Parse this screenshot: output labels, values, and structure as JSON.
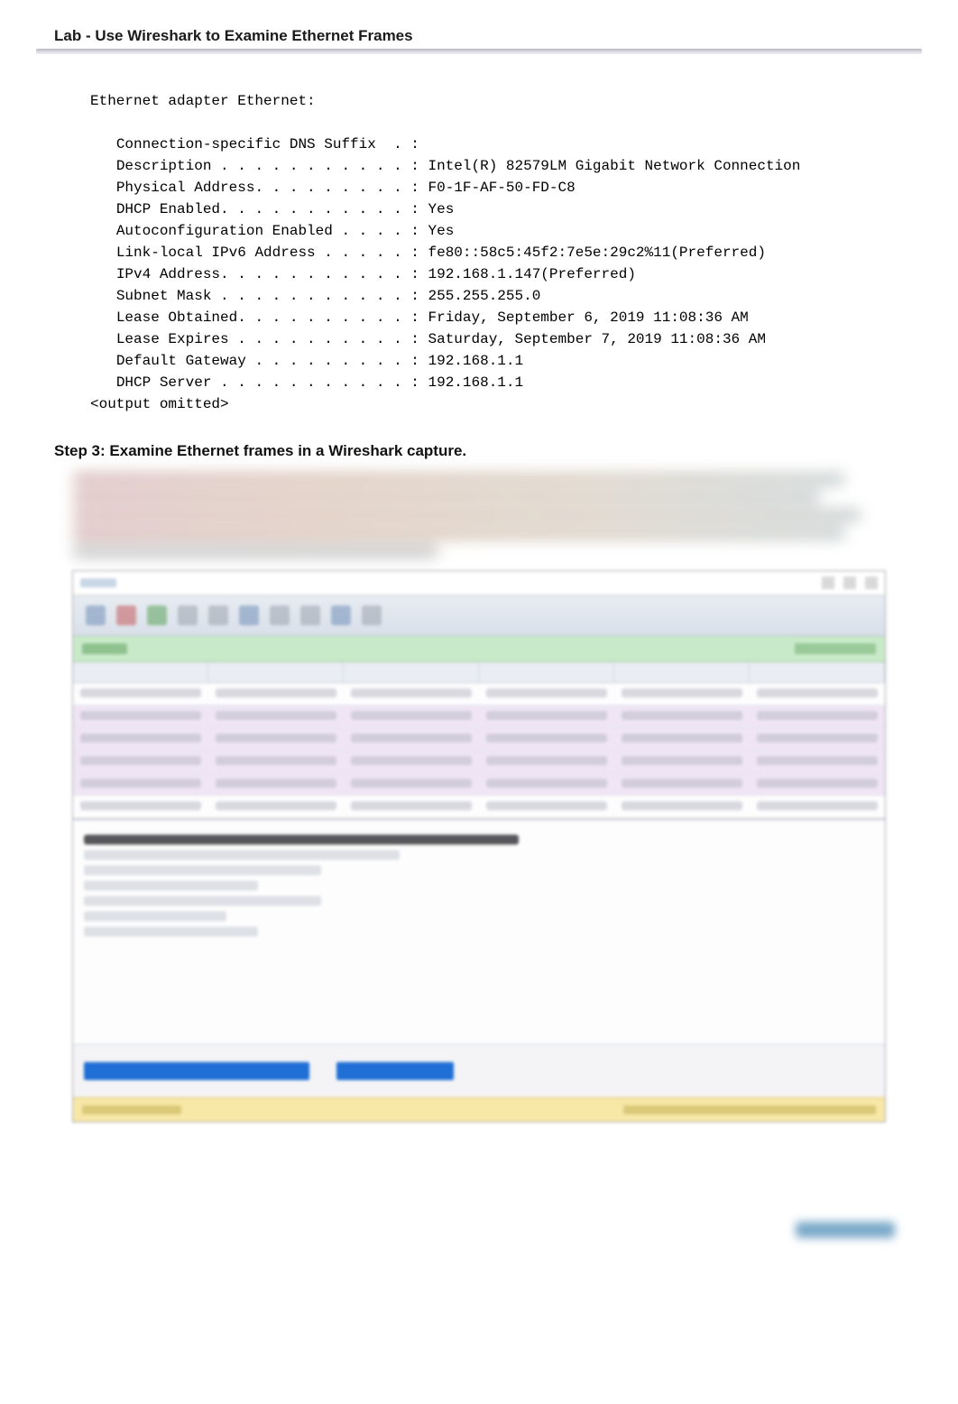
{
  "header": {
    "title": "Lab - Use Wireshark to Examine Ethernet Frames"
  },
  "terminal": {
    "section_title": "Ethernet adapter Ethernet:",
    "lines": [
      {
        "label": "Connection-specific DNS Suffix  . :",
        "value": ""
      },
      {
        "label": "Description . . . . . . . . . . . :",
        "value": "Intel(R) 82579LM Gigabit Network Connection"
      },
      {
        "label": "Physical Address. . . . . . . . . :",
        "value": "F0-1F-AF-50-FD-C8"
      },
      {
        "label": "DHCP Enabled. . . . . . . . . . . :",
        "value": "Yes"
      },
      {
        "label": "Autoconfiguration Enabled . . . . :",
        "value": "Yes"
      },
      {
        "label": "Link-local IPv6 Address . . . . . :",
        "value": "fe80::58c5:45f2:7e5e:29c2%11(Preferred)"
      },
      {
        "label": "IPv4 Address. . . . . . . . . . . :",
        "value": "192.168.1.147(Preferred)"
      },
      {
        "label": "Subnet Mask . . . . . . . . . . . :",
        "value": "255.255.255.0"
      },
      {
        "label": "Lease Obtained. . . . . . . . . . :",
        "value": "Friday, September 6, 2019 11:08:36 AM"
      },
      {
        "label": "Lease Expires . . . . . . . . . . :",
        "value": "Saturday, September 7, 2019 11:08:36 AM"
      },
      {
        "label": "Default Gateway . . . . . . . . . :",
        "value": "192.168.1.1"
      },
      {
        "label": "DHCP Server . . . . . . . . . . . :",
        "value": "192.168.1.1"
      }
    ],
    "omitted": "<output omitted>"
  },
  "step": {
    "heading": "Step 3: Examine Ethernet frames in a Wireshark capture."
  }
}
